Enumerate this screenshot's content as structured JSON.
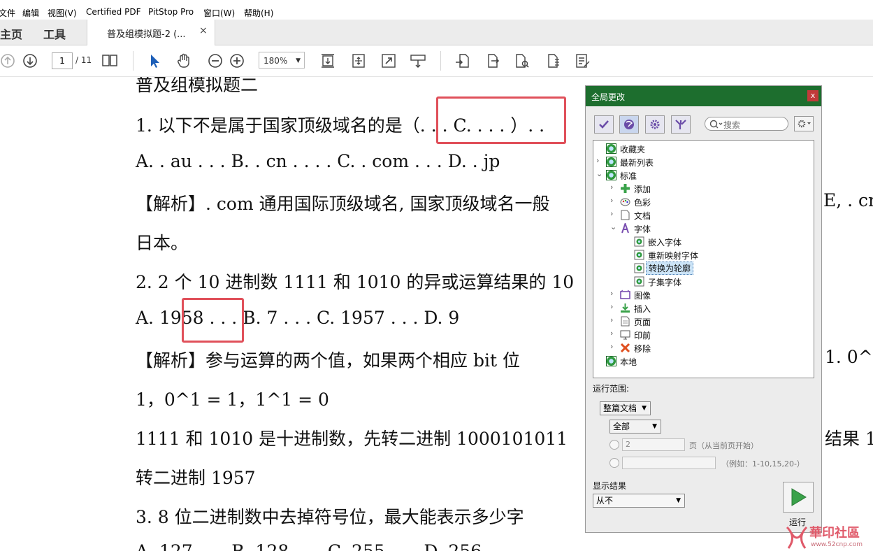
{
  "menu": {
    "items": [
      "文件",
      "编辑",
      "视图(V)",
      "Certified PDF",
      "PitStop Pro",
      "窗口(W)",
      "帮助(H)"
    ]
  },
  "tabs": {
    "home": "主页",
    "tools": "工具",
    "doc_title": "普及组模拟题-2 (...",
    "close": "×"
  },
  "toolbar": {
    "page_current": "1",
    "page_total": "/ 11",
    "zoom": "180%"
  },
  "document": {
    "lines": [
      "普及组模拟题二",
      "1. 以下不是属于国家顶级域名的是（. . . C. . . . ）. .",
      "A. . au . . . B. . cn . . . . C. . com . . . D. . jp",
      "【解析】. com 通用国际顶级域名, 国家顶级域名一般",
      "日本。",
      "2. 2 个 10 进制数 1111 和 1010 的异或运算结果的 10",
      "A. 1958 . . . B. 7 . . . C. 1957 . . . D. 9",
      "【解析】参与运算的两个值，如果两个相应 bit 位",
      "1，0^1 = 1，1^1 = 0",
      "1111 和 1010 是十进制数，先转二进制 1000101011",
      "转二进制 1957",
      "3. 8 位二进制数中去掉符号位，最大能表示多少字",
      "A. 127 . . . B. 128 . . . C. 255 . . . D. 256"
    ],
    "right_fragments": [
      "E, . cn",
      "1. 0^",
      "结果 1"
    ]
  },
  "panel": {
    "title": "全局更改",
    "close": "x",
    "search_placeholder": "搜索",
    "tree": [
      {
        "label": "收藏夹",
        "level": 0,
        "chevron": "",
        "icon": "globe-icon"
      },
      {
        "label": "最新列表",
        "level": 0,
        "chevron": ">",
        "icon": "globe-icon"
      },
      {
        "label": "标准",
        "level": 0,
        "chevron": "v",
        "icon": "globe-icon"
      },
      {
        "label": "添加",
        "level": 1,
        "chevron": ">",
        "icon": "add-icon"
      },
      {
        "label": "色彩",
        "level": 1,
        "chevron": ">",
        "icon": "palette-icon"
      },
      {
        "label": "文档",
        "level": 1,
        "chevron": ">",
        "icon": "document-icon"
      },
      {
        "label": "字体",
        "level": 1,
        "chevron": "v",
        "icon": "font-icon"
      },
      {
        "label": "嵌入字体",
        "level": 2,
        "chevron": "",
        "icon": "action-icon"
      },
      {
        "label": "重新映射字体",
        "level": 2,
        "chevron": "",
        "icon": "action-icon"
      },
      {
        "label": "转换为轮廓",
        "level": 2,
        "chevron": "",
        "icon": "action-icon",
        "selected": true
      },
      {
        "label": "子集字体",
        "level": 2,
        "chevron": "",
        "icon": "action-icon"
      },
      {
        "label": "图像",
        "level": 1,
        "chevron": ">",
        "icon": "image-icon"
      },
      {
        "label": "插入",
        "level": 1,
        "chevron": ">",
        "icon": "insert-icon"
      },
      {
        "label": "页面",
        "level": 1,
        "chevron": ">",
        "icon": "page-icon"
      },
      {
        "label": "印前",
        "level": 1,
        "chevron": ">",
        "icon": "monitor-icon"
      },
      {
        "label": "移除",
        "level": 1,
        "chevron": ">",
        "icon": "remove-icon"
      },
      {
        "label": "本地",
        "level": 0,
        "chevron": "",
        "icon": "globe-icon"
      }
    ],
    "run_scope_label": "运行范围:",
    "scope_select": "整篇文档",
    "scope_sub_select": "全部",
    "page_value": "2",
    "page_hint": "页（从当前页开始）",
    "range_hint": "（例如：1-10,15,20-）",
    "show_results_label": "显示结果",
    "show_results_value": "从不",
    "run_label": "运行"
  },
  "watermark": {
    "text": "華印社區",
    "url": "www.52cnp.com"
  },
  "colors": {
    "panel_title_bg": "#1d6e2e",
    "highlight_box": "#e0505a",
    "selection": "#cce4f7"
  }
}
